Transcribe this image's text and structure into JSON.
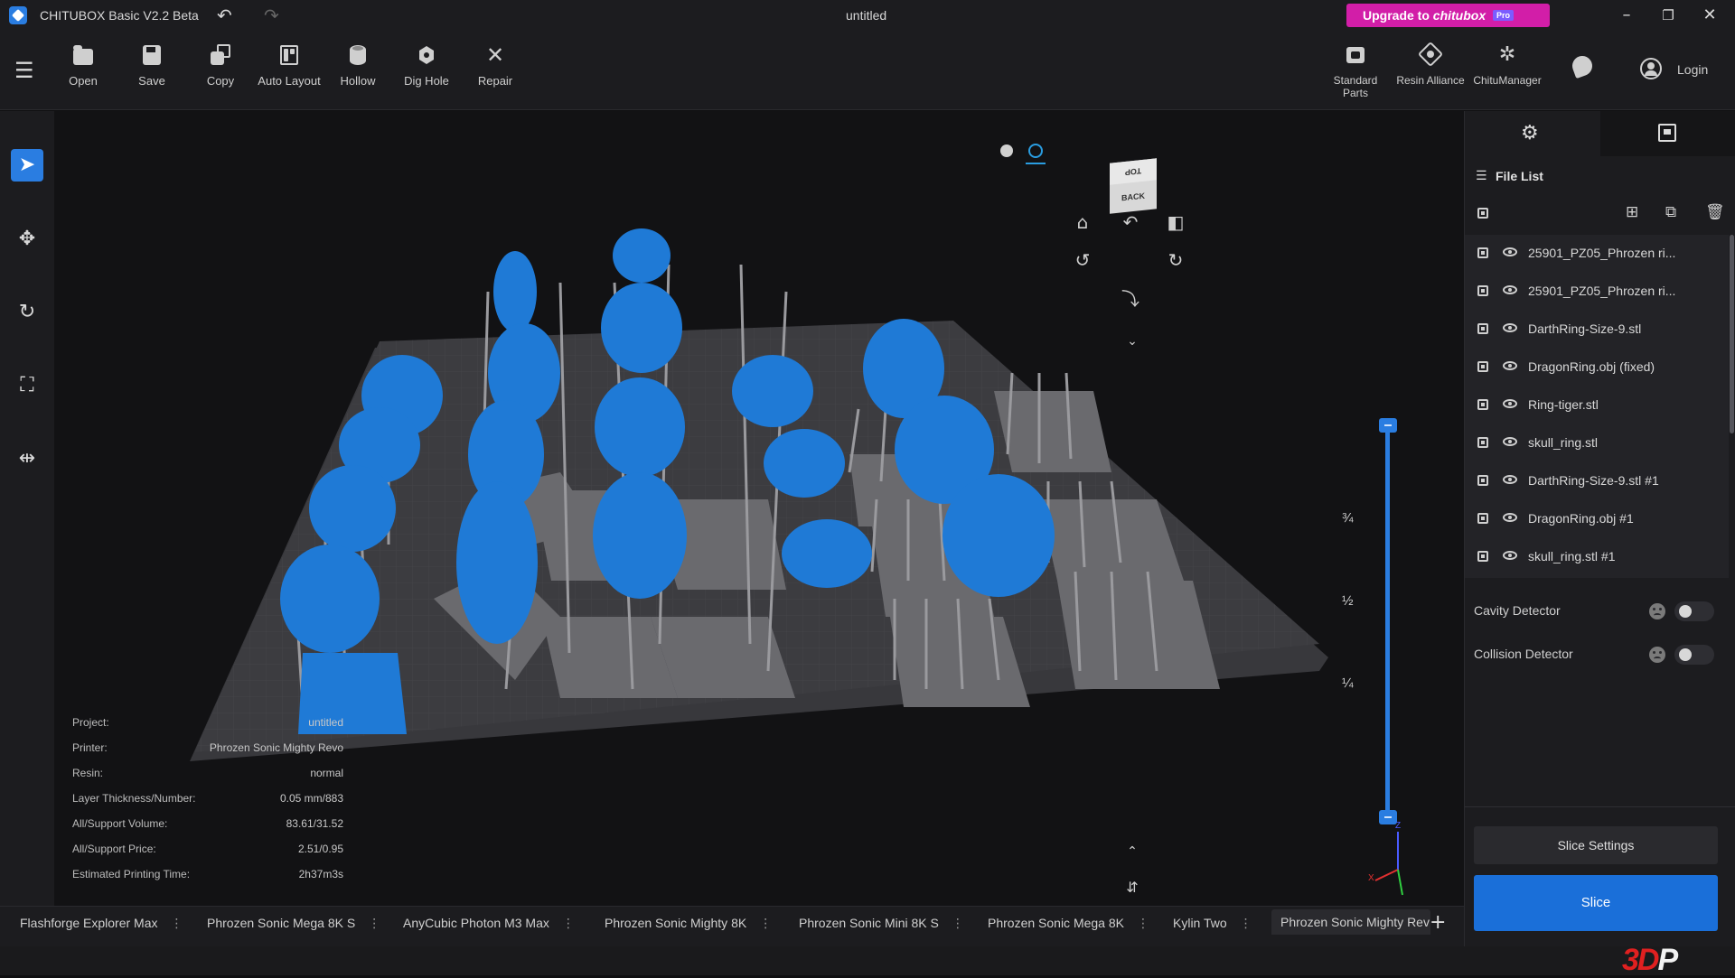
{
  "app": {
    "title": "CHITUBOX Basic V2.2 Beta",
    "document": "untitled",
    "upgrade_label": "Upgrade to",
    "upgrade_brand": "chitubox",
    "upgrade_badge": "Pro",
    "login_label": "Login",
    "accent": "#2a7de1"
  },
  "toolbar": {
    "left": [
      {
        "id": "open",
        "label": "Open",
        "icon": "folder-icon"
      },
      {
        "id": "save",
        "label": "Save",
        "icon": "floppy-icon"
      },
      {
        "id": "copy",
        "label": "Copy",
        "icon": "copy-icon"
      },
      {
        "id": "auto-layout",
        "label": "Auto Layout",
        "icon": "layout-icon"
      },
      {
        "id": "hollow",
        "label": "Hollow",
        "icon": "cylinder-icon"
      },
      {
        "id": "dig-hole",
        "label": "Dig Hole",
        "icon": "cube-icon"
      },
      {
        "id": "repair",
        "label": "Repair",
        "icon": "tools-icon"
      }
    ],
    "right": [
      {
        "id": "standard-parts",
        "label": "Standard Parts",
        "icon": "parts-icon"
      },
      {
        "id": "resin-alliance",
        "label": "Resin Alliance",
        "icon": "resin-icon"
      },
      {
        "id": "chitumanager",
        "label": "ChituManager",
        "icon": "manager-icon"
      }
    ]
  },
  "viewcube": {
    "top": "TOP",
    "back": "BACK"
  },
  "slider": {
    "marks": [
      "¾",
      "½",
      "¼"
    ],
    "lower": 0.0,
    "upper": 1.0
  },
  "info": {
    "rows": [
      {
        "k": "Project:",
        "v": "untitled"
      },
      {
        "k": "Printer:",
        "v": "Phrozen Sonic Mighty Revo"
      },
      {
        "k": "Resin:",
        "v": "normal"
      },
      {
        "k": "Layer Thickness/Number:",
        "v": "0.05 mm/883"
      },
      {
        "k": "All/Support Volume:",
        "v": "83.61/31.52"
      },
      {
        "k": "All/Support Price:",
        "v": "2.51/0.95"
      },
      {
        "k": "Estimated Printing Time:",
        "v": "2h37m3s"
      }
    ]
  },
  "filelist": {
    "title": "File List",
    "files": [
      "25901_PZ05_Phrozen ri...",
      "25901_PZ05_Phrozen ri...",
      "DarthRing-Size-9.stl",
      "DragonRing.obj (fixed)",
      "Ring-tiger.stl",
      "skull_ring.stl",
      "DarthRing-Size-9.stl #1",
      "DragonRing.obj #1",
      "skull_ring.stl #1"
    ]
  },
  "detectors": [
    {
      "label": "Cavity Detector",
      "on": false
    },
    {
      "label": "Collision Detector",
      "on": false
    }
  ],
  "actions": {
    "slice_settings": "Slice Settings",
    "slice": "Slice"
  },
  "printer_tabs": [
    "Flashforge Explorer Max",
    "Phrozen Sonic Mega 8K S",
    "AnyCubic Photon M3 Max",
    "Phrozen Sonic Mighty 8K",
    "Phrozen Sonic Mini 8K S",
    "Phrozen Sonic Mega 8K",
    "Kylin Two",
    "Phrozen Sonic Mighty Rev"
  ],
  "active_printer_tab": 7,
  "brand": {
    "a": "3D",
    "b": "P"
  }
}
